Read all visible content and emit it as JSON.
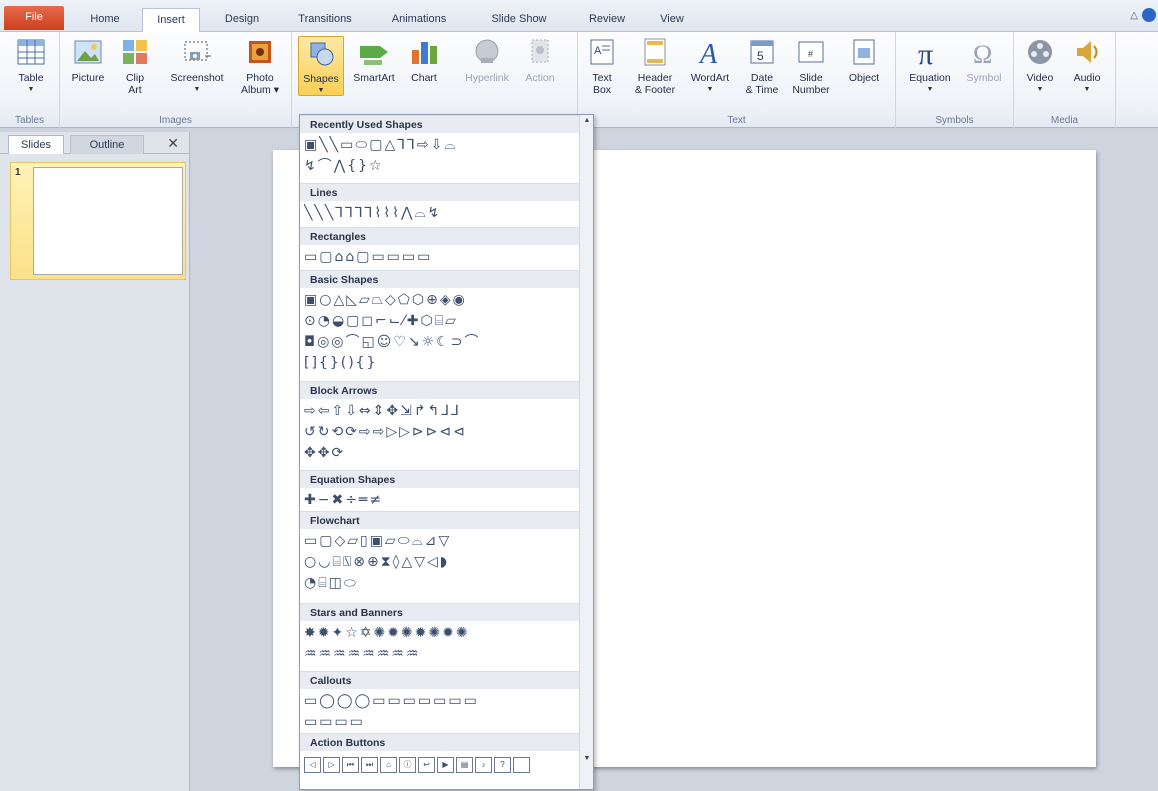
{
  "tabs": [
    "File",
    "Home",
    "Insert",
    "Design",
    "Transitions",
    "Animations",
    "Slide Show",
    "Review",
    "View"
  ],
  "active_tab": "Insert",
  "ribbon": {
    "groups": {
      "tables": "Tables",
      "images": "Images",
      "text": "Text",
      "symbols": "Symbols",
      "media": "Media"
    },
    "buttons": {
      "table": "Table",
      "picture": "Picture",
      "clip_art_1": "Clip",
      "clip_art_2": "Art",
      "screenshot": "Screenshot",
      "photo_album_1": "Photo",
      "photo_album_2": "Album ▾",
      "shapes": "Shapes",
      "smartart": "SmartArt",
      "chart": "Chart",
      "hyperlink": "Hyperlink",
      "action": "Action",
      "text_box_1": "Text",
      "text_box_2": "Box",
      "header_footer_1": "Header",
      "header_footer_2": "& Footer",
      "wordart": "WordArt",
      "date_time_1": "Date",
      "date_time_2": "& Time",
      "slide_number_1": "Slide",
      "slide_number_2": "Number",
      "object": "Object",
      "equation": "Equation",
      "symbol": "Symbol",
      "video": "Video",
      "audio": "Audio"
    }
  },
  "left_pane": {
    "tabs": [
      "Slides",
      "Outline"
    ],
    "close": "✕",
    "slide_number": "1"
  },
  "gallery": {
    "sections": [
      {
        "title": "Recently Used Shapes",
        "rows": [
          "▣╲╲▭⬭▢△⅂⅂⇨⇩⌓",
          "↯⌒⋀{}☆"
        ]
      },
      {
        "title": "Lines",
        "rows": [
          "╲╲╲⅂⅂⅂⅂⌇⌇⌇⋀⌓↯"
        ]
      },
      {
        "title": "Rectangles",
        "rows": [
          "▭▢⌂⌂▢▭▭▭▭"
        ]
      },
      {
        "title": "Basic Shapes",
        "rows": [
          "▣○△◺▱⏢◇⬠⬡⊕◈◉",
          "⊙◔◒▢◻⌐⌙⁄✚⬡⌸▱",
          "◘◎◎⌒◱☺♡↘☼☾⊃⌒",
          "[]{}(){}"
        ]
      },
      {
        "title": "Block Arrows",
        "rows": [
          "⇨⇦⇧⇩⇔⇕✥⇲↱↰⅃⅃",
          "↺↻⟲⟳⇨⇨▷▷⊳⊳⊲⊲",
          "✥✥⟳"
        ]
      },
      {
        "title": "Equation Shapes",
        "rows": [
          "✚−✖÷═≠"
        ]
      },
      {
        "title": "Flowchart",
        "rows": [
          "▭▢◇▱▯▣▱⬭⌓⊿▽",
          "○◡⌸⍂⊗⊕⧗◊△▽◁◗",
          "◔⌸◫⬭"
        ]
      },
      {
        "title": "Stars and Banners",
        "rows": [
          "✸✹✦☆✡✺✹✺✹✺✹✺",
          "♒♒♒♒♒♒♒♒"
        ]
      },
      {
        "title": "Callouts",
        "rows": [
          "▭◯◯◯▭▭▭▭▭▭▭",
          "▭▭▭▭"
        ]
      },
      {
        "title": "Action Buttons",
        "rows": []
      }
    ],
    "action_buttons": [
      "◁",
      "▷",
      "⏮",
      "⏭",
      "⌂",
      "ⓘ",
      "↩",
      "▶",
      "▤",
      "♪",
      "?",
      ""
    ]
  }
}
